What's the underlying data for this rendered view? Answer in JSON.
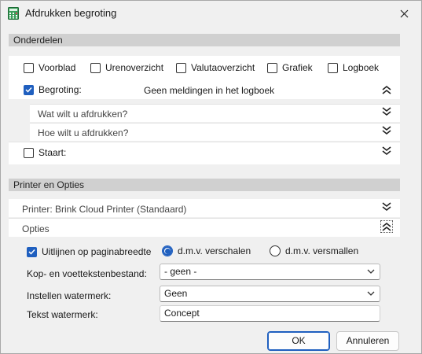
{
  "window": {
    "title": "Afdrukken begroting"
  },
  "sections": {
    "onderdelen": "Onderdelen",
    "printer_opties": "Printer en Opties"
  },
  "parts": {
    "voorblad": {
      "label": "Voorblad",
      "checked": false
    },
    "urenoverzicht": {
      "label": "Urenoverzicht",
      "checked": false
    },
    "valutaoverzicht": {
      "label": "Valutaoverzicht",
      "checked": false
    },
    "grafiek": {
      "label": "Grafiek",
      "checked": false
    },
    "logboek": {
      "label": "Logboek",
      "checked": false
    },
    "begroting": {
      "label": "Begroting:",
      "checked": true,
      "status": "Geen meldingen in het logboek"
    },
    "wat_afdrukken": "Wat wilt u afdrukken?",
    "hoe_afdrukken": "Hoe wilt u afdrukken?",
    "staart": {
      "label": "Staart:",
      "checked": false
    }
  },
  "printer": {
    "label": "Printer: Brink Cloud Printer (Standaard)",
    "opties": "Opties"
  },
  "options": {
    "uitlijnen": {
      "label": "Uitlijnen op paginabreedte",
      "checked": true
    },
    "radio_verschalen": {
      "label": "d.m.v. verschalen",
      "selected": true
    },
    "radio_versmallen": {
      "label": "d.m.v. versmallen",
      "selected": false
    },
    "kop_voet_label": "Kop- en voettekstenbestand:",
    "kop_voet_value": "- geen -",
    "watermerk_label": "Instellen watermerk:",
    "watermerk_value": "Geen",
    "tekst_watermerk_label": "Tekst watermerk:",
    "tekst_watermerk_value": "Concept"
  },
  "buttons": {
    "ok": "OK",
    "annuleren": "Annuleren"
  },
  "colors": {
    "accent": "#1f5fbf",
    "section_header": "#d0d0d0",
    "panel": "#ffffff",
    "dialog": "#f0f0f0"
  },
  "icons": [
    "calculator-icon",
    "close-icon",
    "chevron-double-up-icon",
    "chevron-double-down-icon",
    "chevron-down-icon",
    "check-icon"
  ]
}
